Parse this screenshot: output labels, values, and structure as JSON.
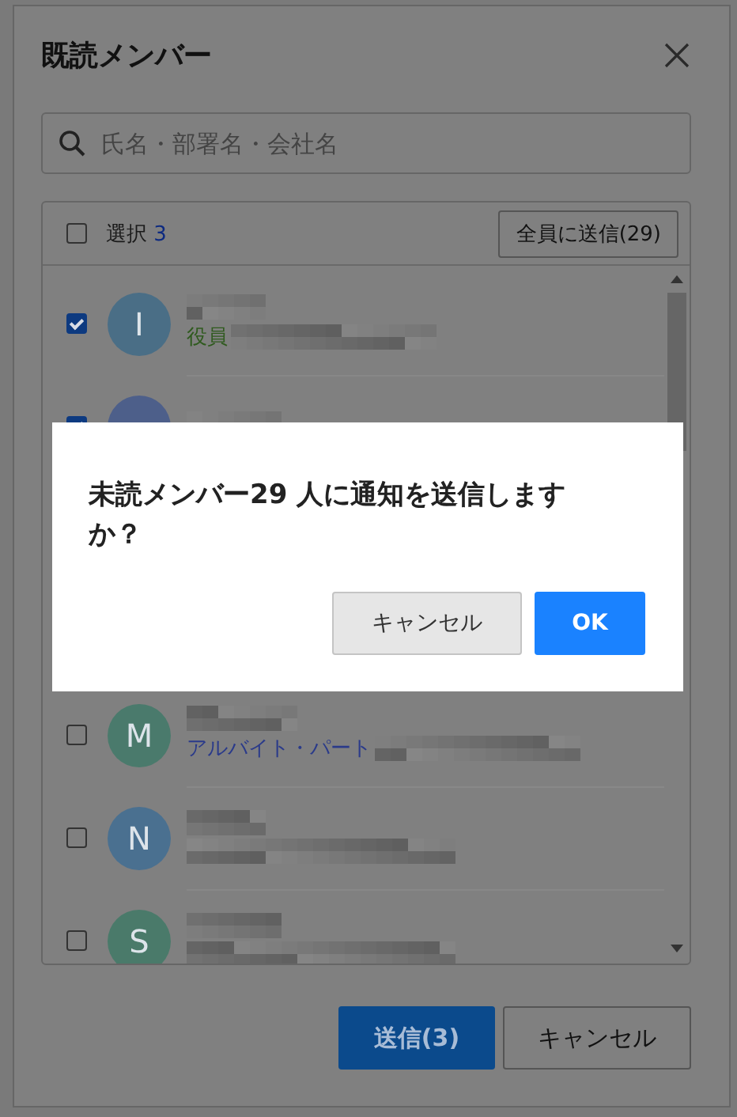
{
  "dialog": {
    "title": "既読メンバー",
    "search": {
      "placeholder": "氏名・部署名・会社名"
    },
    "select_all": {
      "checked": false,
      "label": "選択",
      "count": "3"
    },
    "send_all_button": "全員に送信(29)",
    "members": [
      {
        "initial": "I",
        "color": "#4a6e86",
        "checked": true,
        "role": {
          "text": "役員",
          "color": "#2f5a1e"
        }
      },
      {
        "color": "#4d5f8a",
        "checked": true
      },
      {
        "initial": "M",
        "color": "#4a7a6c",
        "checked": false,
        "role": {
          "text": "アルバイト・パート",
          "color": "#2a3a8a"
        }
      },
      {
        "initial": "N",
        "color": "#4a7090",
        "checked": false
      },
      {
        "initial": "S",
        "color": "#4a7a6a",
        "checked": false
      }
    ],
    "send_button": "送信(3)",
    "cancel_button": "キャンセル"
  },
  "confirm": {
    "message": "未読メンバー29 人に通知を送信しますか？",
    "cancel_button": "キャンセル",
    "ok_button": "OK"
  }
}
